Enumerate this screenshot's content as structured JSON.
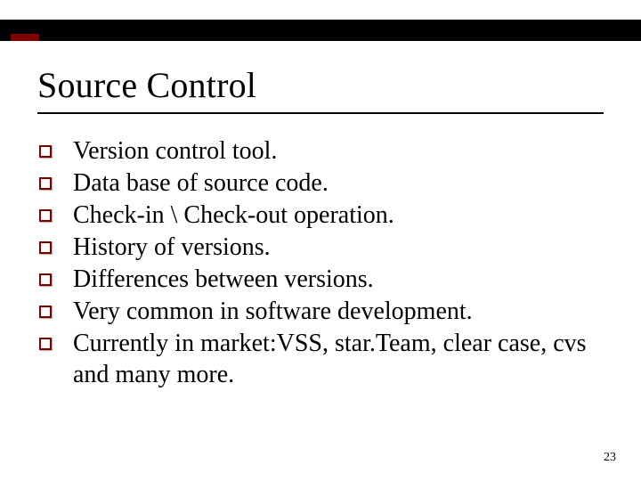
{
  "colors": {
    "accent": "#800000",
    "bar": "#000000"
  },
  "title": "Source Control",
  "bullets": [
    "Version control tool.",
    "Data base of source code.",
    "Check-in \\ Check-out operation.",
    "History of versions.",
    "Differences between versions.",
    "Very common in software development.",
    "Currently in market:VSS, star.Team, clear case, cvs and many more."
  ],
  "page_number": "23"
}
